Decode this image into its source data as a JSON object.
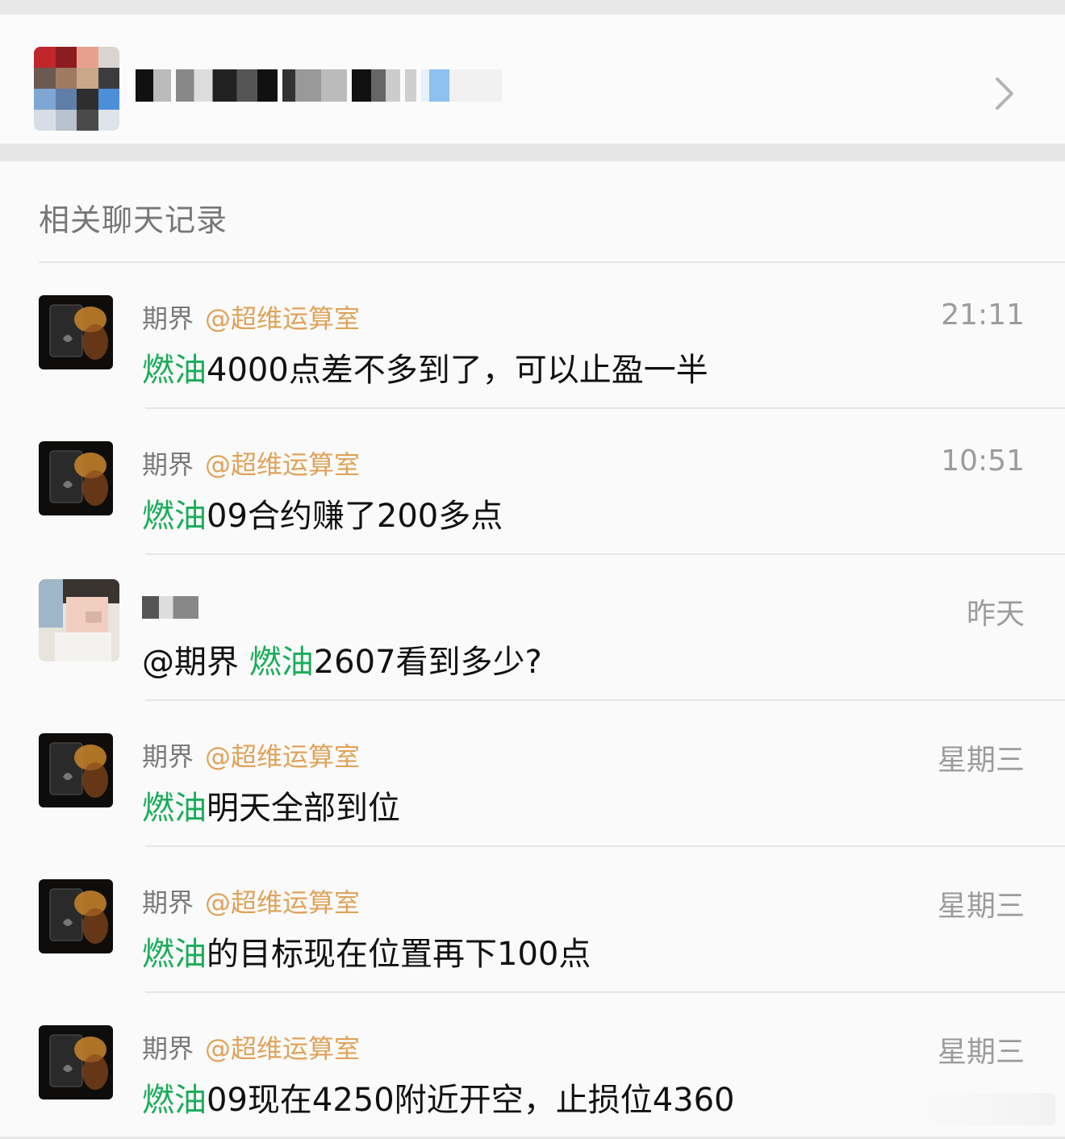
{
  "header": {
    "group_name_redacted": true,
    "chevron_icon": "chevron-right-icon"
  },
  "section": {
    "title": "相关聊天记录"
  },
  "messages": [
    {
      "sender": "期界",
      "mention": "@超维运算室",
      "time": "21:11",
      "keyword": "燃油",
      "text": "4000点差不多到了，可以止盈一半",
      "avatar": "dark-card-avatar"
    },
    {
      "sender": "期界",
      "mention": "@超维运算室",
      "time": "10:51",
      "keyword": "燃油",
      "text": "09合约赚了200多点",
      "avatar": "dark-card-avatar"
    },
    {
      "sender": "",
      "mention": "",
      "time": "昨天",
      "prefix": "@期界 ",
      "keyword": "燃油",
      "text": "2607看到多少?",
      "avatar": "blurred-person-avatar"
    },
    {
      "sender": "期界",
      "mention": "@超维运算室",
      "time": "星期三",
      "keyword": "燃油",
      "text": "明天全部到位",
      "avatar": "dark-card-avatar"
    },
    {
      "sender": "期界",
      "mention": "@超维运算室",
      "time": "星期三",
      "keyword": "燃油",
      "text": "的目标现在位置再下100点",
      "avatar": "dark-card-avatar"
    },
    {
      "sender": "期界",
      "mention": "@超维运算室",
      "time": "星期三",
      "keyword": "燃油",
      "text": "09现在4250附近开空，止损位4360",
      "avatar": "dark-card-avatar"
    }
  ],
  "colors": {
    "keyword": "#1aad5a",
    "mention": "#e0a35a",
    "time": "#9c9c9c",
    "sender": "#7a7a7a"
  }
}
